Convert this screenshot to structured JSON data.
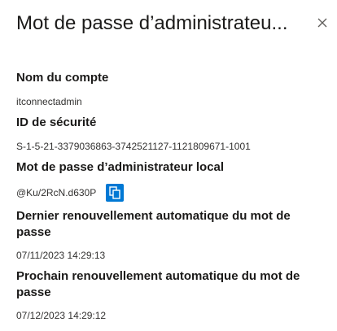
{
  "panel": {
    "title": "Mot de passe d’administrateu..."
  },
  "icons": {
    "close": "close-icon",
    "copy": "copy-icon"
  },
  "colors": {
    "accent": "#0078d4"
  },
  "fields": {
    "account_name_label": "Nom du compte",
    "account_name_value": "itconnectadmin",
    "security_id_label": "ID de sécurité",
    "security_id_value": "S-1-5-21-3379036863-3742521127-1121809671-1001",
    "local_admin_password_label": "Mot de passe d’administrateur local",
    "local_admin_password_value": "@Ku/2RcN.d630P",
    "last_rotation_label": "Dernier renouvellement automatique du mot de passe",
    "last_rotation_value": "07/11/2023 14:29:13",
    "next_rotation_label": "Prochain renouvellement automatique du mot de passe",
    "next_rotation_value": "07/12/2023 14:29:12"
  }
}
